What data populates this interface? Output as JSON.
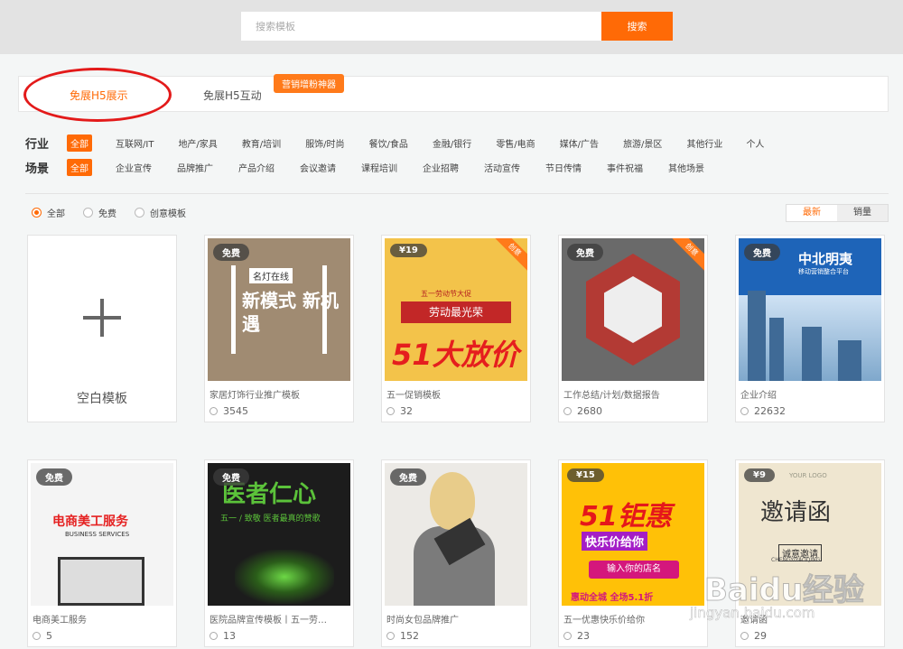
{
  "search": {
    "placeholder": "搜索模板",
    "button_label": "搜索"
  },
  "tabs": [
    {
      "label": "免展H5展示"
    },
    {
      "label": "免展H5互动",
      "badge": "营销增粉神器"
    }
  ],
  "filters": {
    "industry": {
      "title": "行业",
      "items": [
        "全部",
        "互联网/IT",
        "地产/家具",
        "教育/培训",
        "服饰/时尚",
        "餐饮/食品",
        "金融/银行",
        "零售/电商",
        "媒体/广告",
        "旅游/景区",
        "其他行业",
        "个人"
      ]
    },
    "scene": {
      "title": "场景",
      "items": [
        "全部",
        "企业宣传",
        "品牌推广",
        "产品介绍",
        "会议邀请",
        "课程培训",
        "企业招聘",
        "活动宣传",
        "节日传情",
        "事件祝福",
        "其他场景"
      ]
    }
  },
  "radios": [
    "全部",
    "免费",
    "创意模板"
  ],
  "sort": [
    "最新",
    "销量"
  ],
  "blank_card": {
    "label": "空白模板"
  },
  "cards": [
    {
      "price": "免费",
      "title": "家居灯饰行业推广模板",
      "views": "3545",
      "brand": "名灯在线",
      "headline": "新模式 新机遇"
    },
    {
      "price": "¥19",
      "ribbon": "创意",
      "title": "五一促销模板",
      "views": "32",
      "banner": "劳动最光荣",
      "sub": "五一劳动节大促",
      "headline": "51大放价"
    },
    {
      "price": "免费",
      "ribbon": "创意",
      "title": "工作总结/计划/数据报告",
      "views": "2680"
    },
    {
      "price": "免费",
      "title": "企业介绍",
      "views": "22632",
      "name": "中北明夷",
      "slogan": "移动营销整合平台"
    },
    {
      "price": "免费",
      "title": "电商美工服务",
      "views": "5",
      "headline": "电商美工服务",
      "sub": "BUSINESS SERVICES"
    },
    {
      "price": "免费",
      "title": "医院品牌宣传模板丨五一劳…",
      "views": "13",
      "headline": "医者仁心",
      "sub": "五一 / 致敬 医者最真的赞歌"
    },
    {
      "price": "免费",
      "title": "时尚女包品牌推广",
      "views": "152"
    },
    {
      "price": "¥15",
      "title": "五一优惠快乐价给你",
      "views": "23",
      "headline": "51钜惠",
      "sub": "快乐价给你",
      "input": "输入你的店名",
      "foot": "惠动全城 全场5.1折"
    },
    {
      "price": "¥9",
      "title": "邀请函",
      "views": "29",
      "logo": "YOUR LOGO",
      "headline": "邀请函",
      "sub": "诚意邀请",
      "en": "CHENGYIYAOQING"
    }
  ],
  "watermark": {
    "brand": "Baidu经验",
    "url": "jingyan.baidu.com"
  },
  "colors": {
    "accent": "#ff6a06",
    "highlight_ellipse": "#e31a1a"
  }
}
